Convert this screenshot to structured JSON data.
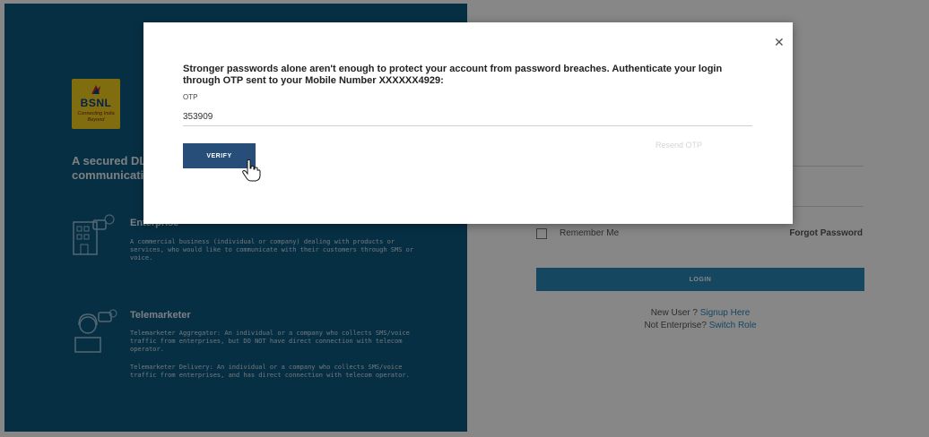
{
  "brand": {
    "name": "BSNL",
    "tagline": "Connecting India Beyond",
    "colors": {
      "panel": "#0f5a80",
      "logo": "#f2cf1f",
      "accent": "#2a86b6",
      "verify": "#264e79"
    }
  },
  "intro": {
    "text": "A secured DLT platform for registration of commercial communications"
  },
  "roles": [
    {
      "title": "Enterprise",
      "icon": "enterprise-building-icon",
      "description": "A commercial business (individual or company) dealing with products or services, who would like to communicate with their customers through SMS or voice."
    },
    {
      "title": "Telemarketer",
      "icon": "telemarketer-headset-icon",
      "description_aggregator": "Telemarketer Aggregator: An individual or a company who collects SMS/voice traffic from enterprises, but DO NOT have direct connection with telecom operator.",
      "description_delivery": "Telemarketer Delivery: An individual or a company who collects SMS/voice traffic from enterprises, and has direct connection with telecom operator."
    }
  ],
  "login": {
    "remember_label": "Remember Me",
    "forgot_label": "Forgot Password",
    "login_label": "LOGIN",
    "new_user_text": "New User ?",
    "signup_link": "Signup Here",
    "not_enterprise_text": "Not Enterprise?",
    "switch_role_link": "Switch Role"
  },
  "modal": {
    "close_icon": "close-icon",
    "message": "Stronger passwords alone aren't enough to protect your account from password breaches. Authenticate your login through OTP sent to your Mobile Number XXXXXX4929:",
    "otp_label": "OTP",
    "otp_value": "353909",
    "resend_label": "Resend OTP",
    "verify_label": "VERIFY"
  }
}
